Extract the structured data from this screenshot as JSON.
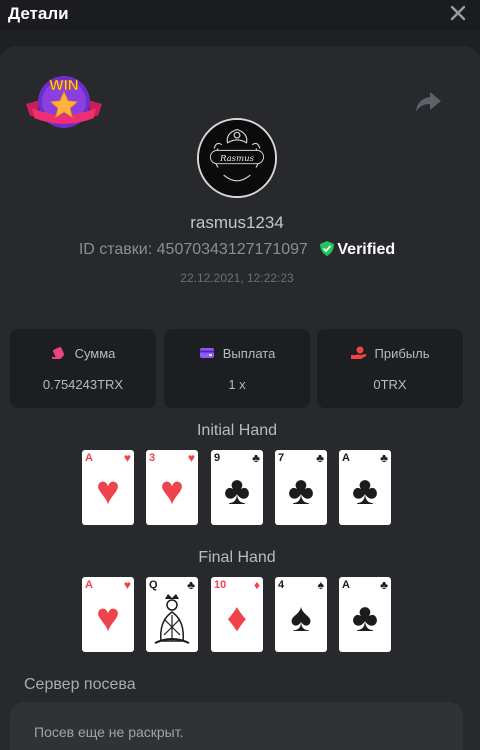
{
  "header": {
    "title": "Детали"
  },
  "player": {
    "username": "rasmus1234",
    "bet_id_label": "ID ставки:",
    "bet_id": "45070343127171097",
    "verified_label": "Verified",
    "date": "22.12.2021, 12:22:23"
  },
  "badge": {
    "text": "WIN"
  },
  "stats": [
    {
      "label": "Сумма",
      "value": "0.754243TRX",
      "icon": "coins-icon",
      "color": "#e8457e"
    },
    {
      "label": "Выплата",
      "value": "1 x",
      "icon": "wallet-icon",
      "color": "#8b5cf6"
    },
    {
      "label": "Прибыль",
      "value": "0TRX",
      "icon": "hand-coin-icon",
      "color": "#ef4444"
    }
  ],
  "initial_hand": {
    "title": "Initial Hand",
    "cards": [
      {
        "rank": "A",
        "suit": "♥",
        "color": "red"
      },
      {
        "rank": "3",
        "suit": "♥",
        "color": "red"
      },
      {
        "rank": "9",
        "suit": "♣",
        "color": "black"
      },
      {
        "rank": "7",
        "suit": "♣",
        "color": "black"
      },
      {
        "rank": "A",
        "suit": "♣",
        "color": "black"
      }
    ]
  },
  "final_hand": {
    "title": "Final Hand",
    "cards": [
      {
        "rank": "A",
        "suit": "♥",
        "color": "red"
      },
      {
        "rank": "Q",
        "suit": "♣",
        "color": "black",
        "face": true
      },
      {
        "rank": "10",
        "suit": "♦",
        "color": "red"
      },
      {
        "rank": "4",
        "suit": "♠",
        "color": "black"
      },
      {
        "rank": "A",
        "suit": "♣",
        "color": "black"
      }
    ]
  },
  "seed": {
    "label": "Сервер посева",
    "value": "Посев еще не раскрыт."
  }
}
